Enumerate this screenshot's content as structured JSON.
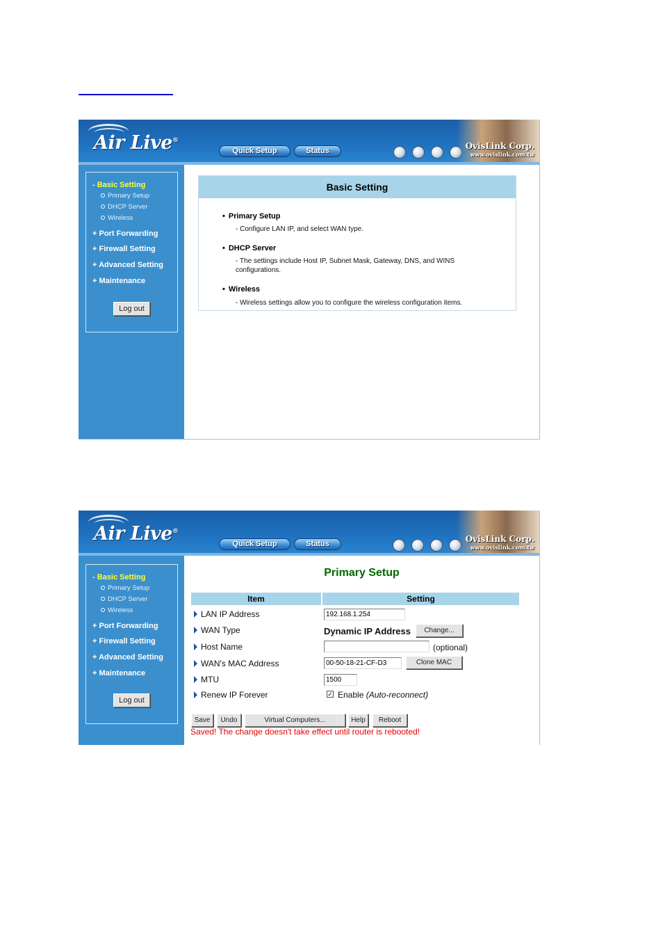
{
  "header": {
    "logo": "Air Live",
    "logo_mark": "®",
    "nav": [
      "Quick Setup",
      "Status"
    ],
    "brand": "OvisLink Corp.",
    "brand_url": "www.ovislink.com.tw"
  },
  "sidebar": {
    "active": "- Basic Setting",
    "subitems": [
      "Primary Setup",
      "DHCP Server",
      "Wireless"
    ],
    "items": [
      "+ Port Forwarding",
      "+ Firewall Setting",
      "+ Advanced Setting",
      "+ Maintenance"
    ],
    "logout": "Log out"
  },
  "basic_setting": {
    "title": "Basic Setting",
    "sections": [
      {
        "title": "Primary Setup",
        "desc": "- Configure LAN IP, and select WAN type."
      },
      {
        "title": "DHCP Server",
        "desc": "- The settings include Host IP, Subnet Mask, Gateway, DNS, and WINS configurations."
      },
      {
        "title": "Wireless",
        "desc": "- Wireless settings allow you to configure the wireless configuration items."
      }
    ]
  },
  "primary_setup": {
    "title": "Primary Setup",
    "col_item": "Item",
    "col_setting": "Setting",
    "rows": [
      {
        "label": "LAN IP Address",
        "value": "192.168.1.254"
      },
      {
        "label": "WAN Type",
        "value": "Dynamic IP Address",
        "button": "Change..."
      },
      {
        "label": "Host Name",
        "value": "",
        "note": "(optional)"
      },
      {
        "label": "WAN's MAC Address",
        "value": "00-50-18-21-CF-D3",
        "button": "Clone MAC"
      },
      {
        "label": "MTU",
        "value": "1500"
      },
      {
        "label": "Renew IP Forever",
        "check": "✓",
        "check_label": "Enable",
        "check_note": "(Auto-reconnect)"
      }
    ],
    "buttons": [
      "Save",
      "Undo",
      "Virtual Computers...",
      "Help",
      "Reboot"
    ],
    "message": "Saved! The change doesn't take effect until router is rebooted!"
  }
}
